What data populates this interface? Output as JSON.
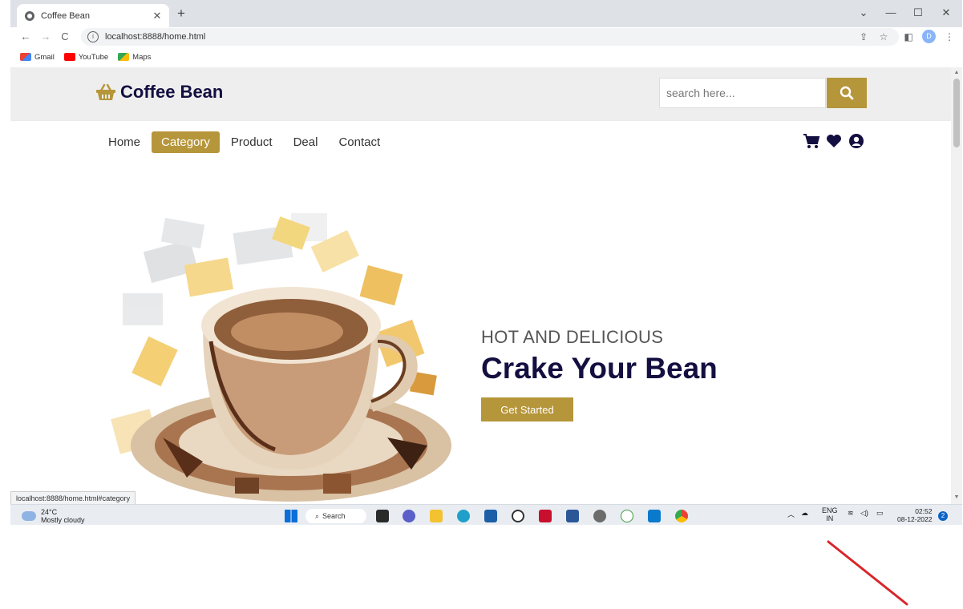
{
  "browser": {
    "tab_title": "Coffee Bean",
    "url": "localhost:8888/home.html",
    "bookmarks": [
      "Gmail",
      "YouTube",
      "Maps"
    ],
    "profile_initial": "D",
    "status_url": "localhost:8888/home.html#category"
  },
  "site": {
    "logo": "Coffee Bean",
    "search_placeholder": "search here...",
    "nav": [
      "Home",
      "Category",
      "Product",
      "Deal",
      "Contact"
    ],
    "active_nav": "Category",
    "header_icons": [
      "cart-icon",
      "heart-icon",
      "user-icon"
    ],
    "brand_color": "#b6963a",
    "title_color": "#130f40"
  },
  "hero": {
    "subtitle": "HOT AND DELICIOUS",
    "title": "Crake Your Bean",
    "button": "Get Started"
  },
  "taskbar": {
    "temperature": "24°C",
    "condition": "Mostly cloudy",
    "search_label": "Search",
    "language": "ENG",
    "language_region": "IN",
    "time": "02:52",
    "date": "08-12-2022",
    "notifications": "2"
  },
  "annotation": {
    "arrow_color": "#d9252a"
  }
}
